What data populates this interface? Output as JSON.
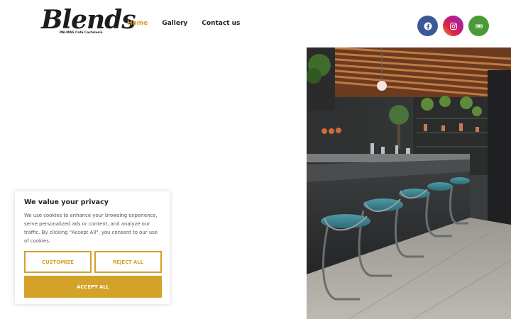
{
  "logo": {
    "script": "Blends",
    "tagline": "PALMAS Café Coctelería"
  },
  "nav": {
    "items": [
      "Home",
      "Gallery",
      "Contact us"
    ],
    "active": "Home"
  },
  "social": [
    {
      "icon": "facebook-icon",
      "color": "#3b5998"
    },
    {
      "icon": "instagram-icon",
      "color": "#c13584"
    },
    {
      "icon": "tripadvisor-icon",
      "color": "#4a9b38"
    }
  ],
  "hero": {
    "icon": "cafe-bar-photo"
  },
  "cookie": {
    "title": "We value your privacy",
    "text": "We use cookies to enhance your browsing experience, serve personalized ads or content, and analyze our traffic. By clicking \"Accept All\", you consent to our use of cookies.",
    "customize": "CUSTOMIZE",
    "reject": "REJECT ALL",
    "accept": "ACCEPT ALL"
  },
  "colors": {
    "accent": "#d4a129",
    "text": "#1f1f1f"
  }
}
